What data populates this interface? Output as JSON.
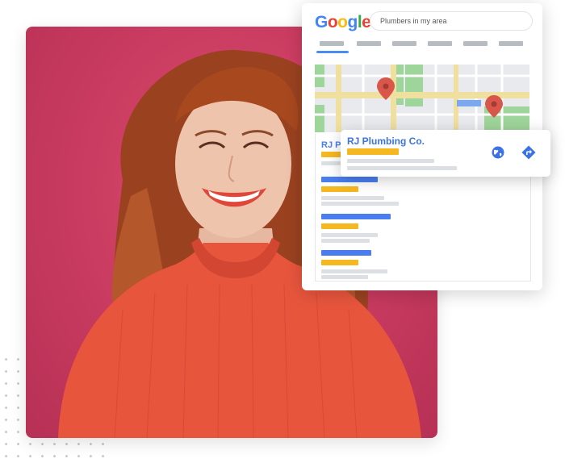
{
  "search": {
    "query": "Plumbers in my area",
    "logo_letters": [
      {
        "ch": "G",
        "color": "#4285F4"
      },
      {
        "ch": "o",
        "color": "#EA4335"
      },
      {
        "ch": "o",
        "color": "#FBBC05"
      },
      {
        "ch": "g",
        "color": "#4285F4"
      },
      {
        "ch": "l",
        "color": "#34A853"
      },
      {
        "ch": "e",
        "color": "#EA4335"
      }
    ]
  },
  "listing": {
    "business_name": "RJ Plumbing Co.",
    "partial_name": "RJ P",
    "icons": [
      "globe-icon",
      "directions-icon"
    ]
  },
  "colors": {
    "background": "#ffffff",
    "photo_bg": "#cc3d62",
    "accent_blue": "#4a7ef0",
    "accent_yellow": "#f6b820",
    "map_pin": "#d9574a",
    "map_green": "#9ed59a"
  }
}
